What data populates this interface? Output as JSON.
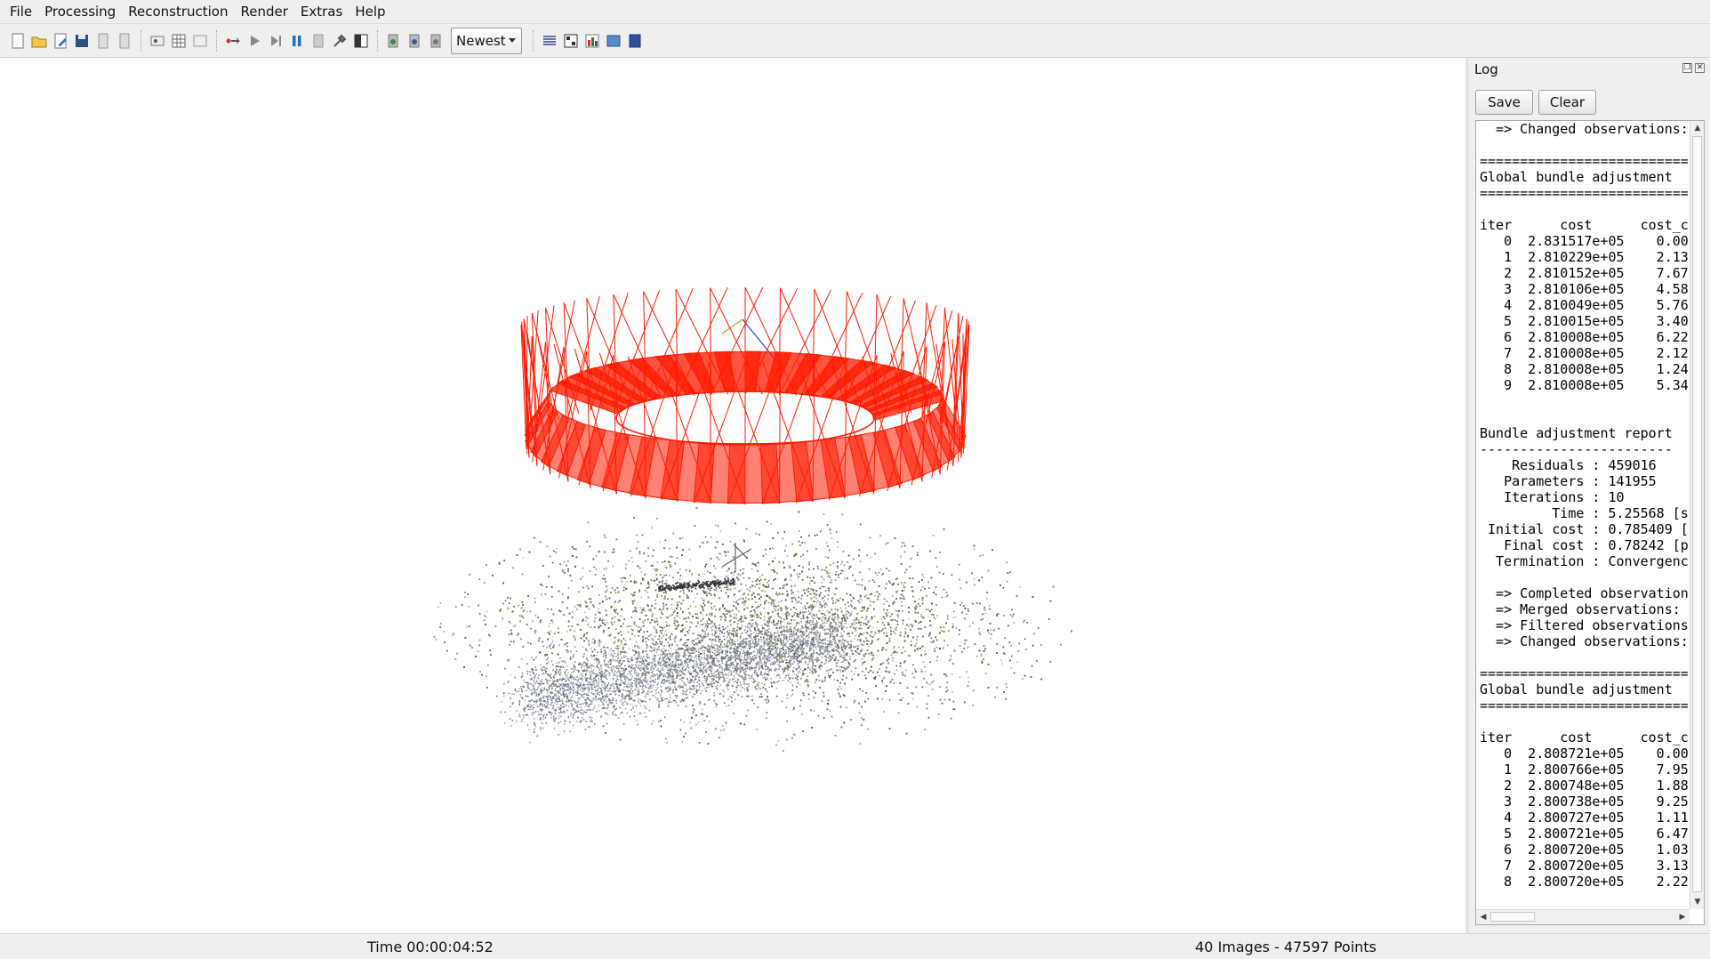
{
  "menu": [
    "File",
    "Processing",
    "Reconstruction",
    "Render",
    "Extras",
    "Help"
  ],
  "toolbar": {
    "groups": [
      [
        "new-project-icon",
        "open-project-icon",
        "edit-project-icon",
        "save-project-icon",
        "import-icon",
        "export-icon"
      ],
      [
        "feature-extraction-icon",
        "feature-matching-icon",
        "database-management-icon"
      ],
      [
        "automatic-reconstruction-icon",
        "play-icon",
        "step-icon",
        "pause-icon",
        "reset-icon",
        "settings-icon",
        "grab-image-icon"
      ],
      [
        "render-options-icon",
        "camera-icon",
        "movie-icon"
      ]
    ],
    "mode_select": "Newest",
    "trailing_icons": [
      "reconstruction-stats-icon",
      "match-matrix-icon",
      "log-icon",
      "image-viewer-icon",
      "info-icon"
    ]
  },
  "log": {
    "title": "Log",
    "save_label": "Save",
    "clear_label": "Clear",
    "lines": [
      "  => Changed observations: ",
      "",
      "=============================",
      "Global bundle adjustment",
      "=============================",
      "",
      "iter      cost      cost_c",
      "   0  2.831517e+05    0.00",
      "   1  2.810229e+05    2.13",
      "   2  2.810152e+05    7.67",
      "   3  2.810106e+05    4.58",
      "   4  2.810049e+05    5.76",
      "   5  2.810015e+05    3.40",
      "   6  2.810008e+05    6.22",
      "   7  2.810008e+05    2.12",
      "   8  2.810008e+05    1.24",
      "   9  2.810008e+05    5.34",
      "",
      "",
      "Bundle adjustment report",
      "------------------------",
      "    Residuals : 459016",
      "   Parameters : 141955",
      "   Iterations : 10",
      "         Time : 5.25568 [s",
      " Initial cost : 0.785409 [",
      "   Final cost : 0.78242 [p",
      "  Termination : Convergenc",
      "",
      "  => Completed observation",
      "  => Merged observations: ",
      "  => Filtered observations",
      "  => Changed observations: ",
      "",
      "=============================",
      "Global bundle adjustment",
      "=============================",
      "",
      "iter      cost      cost_c",
      "   0  2.808721e+05    0.00",
      "   1  2.800766e+05    7.95",
      "   2  2.800748e+05    1.88",
      "   3  2.800738e+05    9.25",
      "   4  2.800727e+05    1.11",
      "   5  2.800721e+05    6.47",
      "   6  2.800720e+05    1.03",
      "   7  2.800720e+05    3.13",
      "   8  2.800720e+05    2.22"
    ]
  },
  "status": {
    "time": "Time 00:00:04:52",
    "counts": "40 Images - 47597 Points"
  },
  "scene": {
    "camera_count": 40,
    "camera_color": "#ff1a00",
    "point_colors": [
      "#6b7a3a",
      "#8a9a55",
      "#505a30",
      "#9a9a9a",
      "#707070",
      "#b0b0b8",
      "#5a6248",
      "#7c6a55"
    ]
  }
}
